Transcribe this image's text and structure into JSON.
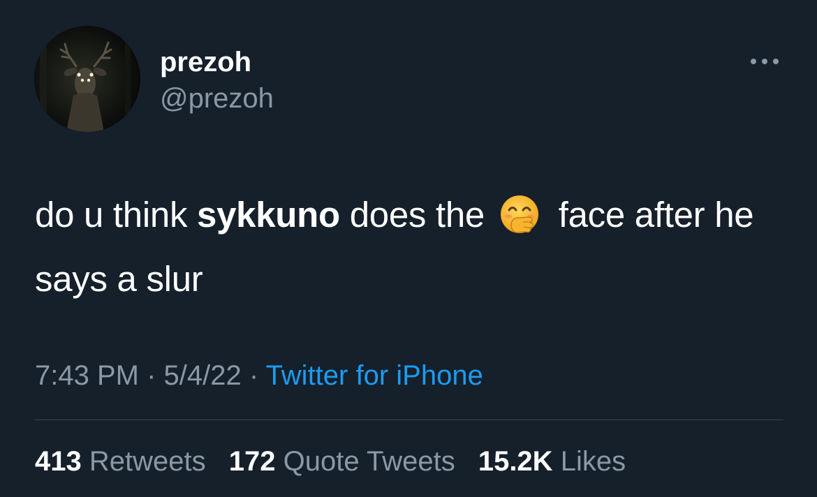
{
  "user": {
    "display_name": "prezoh",
    "handle": "@prezoh",
    "avatar_icon": "deer-avatar"
  },
  "more_icon": "more-horizontal-icon",
  "tweet": {
    "text_part1": "do u think ",
    "mention": "sykkuno",
    "text_part2": " does the ",
    "emoji_name": "face-with-hand-over-mouth-icon",
    "text_part3": " face after he says a slur"
  },
  "meta": {
    "time": "7:43 PM",
    "separator1": " · ",
    "date": "5/4/22",
    "separator2": " · ",
    "source": "Twitter for iPhone"
  },
  "stats": {
    "retweets_count": "413",
    "retweets_label": "Retweets",
    "quotes_count": "172",
    "quotes_label": "Quote Tweets",
    "likes_count": "15.2K",
    "likes_label": "Likes"
  },
  "colors": {
    "background": "#15202b",
    "primary_text": "#ffffff",
    "secondary_text": "#8b98a5",
    "link": "#1d9bf0",
    "divider": "#38444d"
  }
}
